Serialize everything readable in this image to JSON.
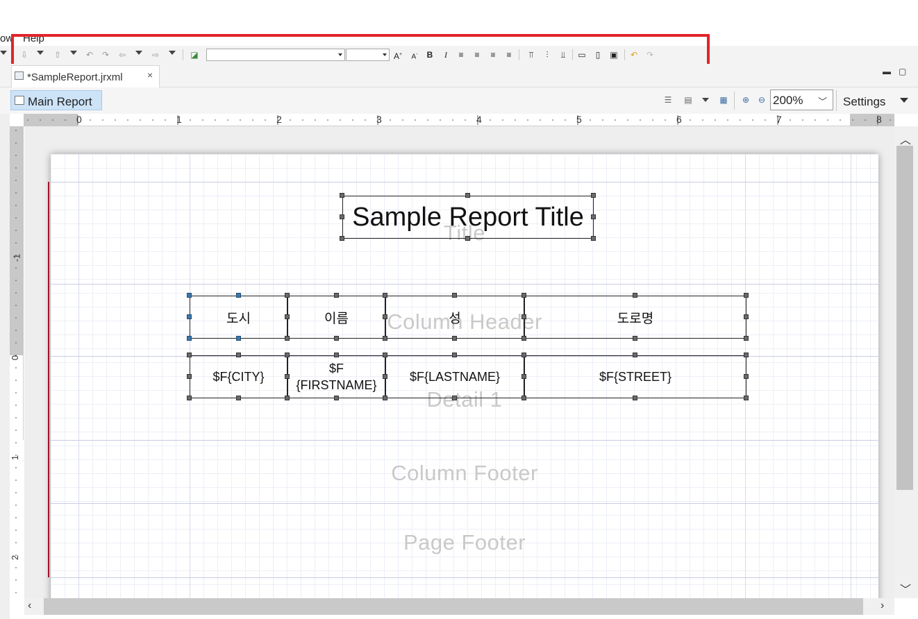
{
  "menu": {
    "partial_item": "ow",
    "help": "Help"
  },
  "toolbar": {
    "font_name": "",
    "font_size": "",
    "increase_font": "A",
    "decrease_font": "A",
    "bold": "B",
    "italic": "I"
  },
  "editor_tab": {
    "label": "*SampleReport.jrxml",
    "close": "×"
  },
  "report_toolbar": {
    "main_report": "Main Report",
    "zoom": "200%",
    "settings": "Settings"
  },
  "ruler": {
    "h_ticks": [
      "0",
      "1",
      "2",
      "3",
      "4",
      "5",
      "6",
      "7",
      "8"
    ],
    "v_ticks": [
      "-1",
      "0",
      "1",
      "2"
    ]
  },
  "bands": {
    "title": "Title",
    "column_header": "Column Header",
    "detail": "Detail 1",
    "column_footer": "Column Footer",
    "page_footer": "Page Footer"
  },
  "report": {
    "title": "Sample Report Title",
    "headers": [
      "도시",
      "이름",
      "성",
      "도로명"
    ],
    "fields": [
      "$F{CITY}",
      "$F\n{FIRSTNAME}",
      "$F{LASTNAME}",
      "$F{STREET}"
    ]
  },
  "colors": {
    "selection_handle": "#3d78a9",
    "highlight_box": "#e2232a",
    "active_tab_bg": "#cde3f7"
  }
}
